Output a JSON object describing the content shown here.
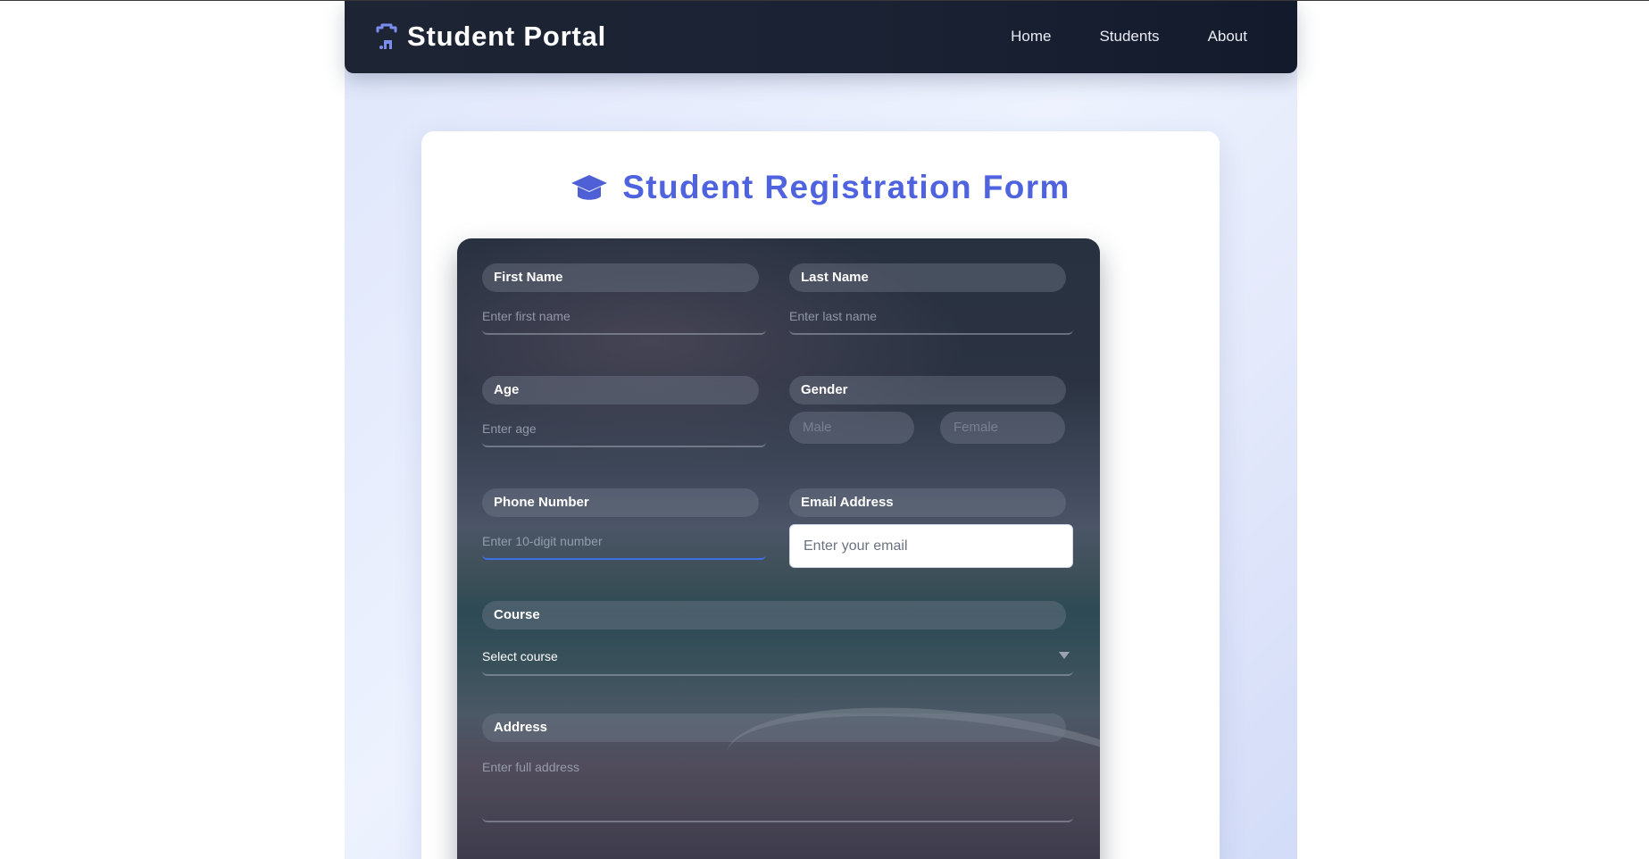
{
  "header": {
    "brand_icon": "student-icon",
    "title": "Student Portal",
    "nav": [
      "Home",
      "Students",
      "About"
    ]
  },
  "form": {
    "title_icon": "graduation-cap-icon",
    "title": "Student Registration Form",
    "accent_color": "#4f63df",
    "first_name": {
      "label": "First Name",
      "placeholder": "Enter first name"
    },
    "last_name": {
      "label": "Last Name",
      "placeholder": "Enter last name"
    },
    "age": {
      "label": "Age",
      "placeholder": "Enter age"
    },
    "gender": {
      "label": "Gender",
      "options": [
        "Male",
        "Female"
      ]
    },
    "phone": {
      "label": "Phone Number",
      "placeholder": "Enter 10-digit number"
    },
    "email": {
      "label": "Email Address",
      "placeholder": "Enter your email"
    },
    "course": {
      "label": "Course",
      "value": "Select course"
    },
    "address": {
      "label": "Address",
      "placeholder": "Enter full address"
    }
  }
}
